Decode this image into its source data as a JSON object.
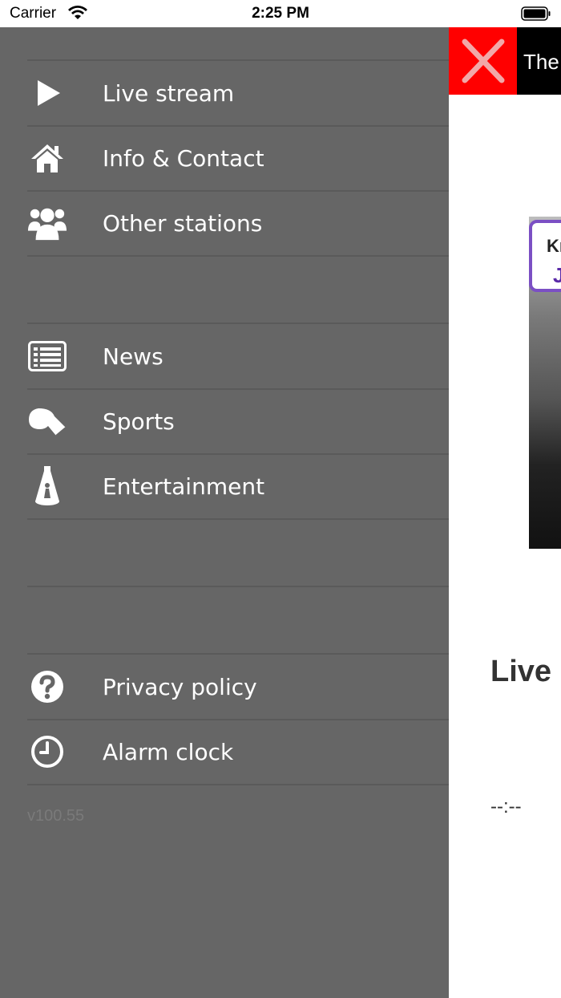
{
  "status_bar": {
    "carrier": "Carrier",
    "time": "2:25 PM"
  },
  "menu": {
    "section1": [
      {
        "label": "Live stream",
        "icon": "play-icon"
      },
      {
        "label": "Info & Contact",
        "icon": "home-icon"
      },
      {
        "label": "Other stations",
        "icon": "users-icon"
      }
    ],
    "section2": [
      {
        "label": "News",
        "icon": "newspaper-icon"
      },
      {
        "label": "Sports",
        "icon": "whistle-icon"
      },
      {
        "label": "Entertainment",
        "icon": "spotlight-icon"
      }
    ],
    "section3": [
      {
        "label": "Privacy policy",
        "icon": "question-icon"
      },
      {
        "label": "Alarm clock",
        "icon": "clock-icon"
      }
    ],
    "version": "v100.55"
  },
  "main": {
    "header_text": "The",
    "badge_line1": "Kr",
    "badge_line2": "J",
    "live_title": "Live",
    "time_display": "--:--"
  },
  "colors": {
    "drawer_bg": "#666666",
    "close_bg": "#ff0000",
    "accent_purple": "#7b4fc4"
  }
}
